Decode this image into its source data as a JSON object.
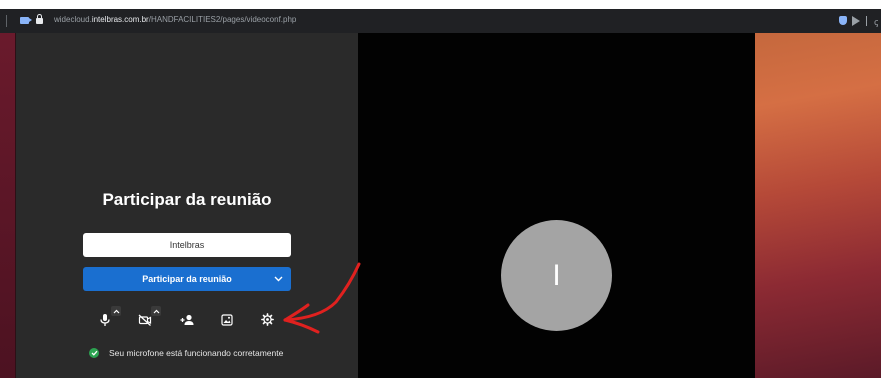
{
  "browser": {
    "url_prefix": "widecloud.",
    "url_domain": "intelbras.com.br",
    "url_path": "/HANDFACILITIES2/pages/videoconf.php",
    "extension_glyph": "ꞔ"
  },
  "prejoin": {
    "title": "Participar da reunião",
    "name_value": "Intelbras",
    "join_label": "Participar da reunião",
    "status_text": "Seu microfone está funcionando corretamente"
  },
  "preview": {
    "avatar_initial": "I"
  },
  "toolbar": {
    "icons": [
      "microphone-icon",
      "camera-off-icon",
      "invite-icon",
      "background-icon",
      "settings-icon"
    ]
  },
  "colors": {
    "accent": "#1a6fd0",
    "status_ok": "#2ca351",
    "annotation": "#e0211f"
  }
}
